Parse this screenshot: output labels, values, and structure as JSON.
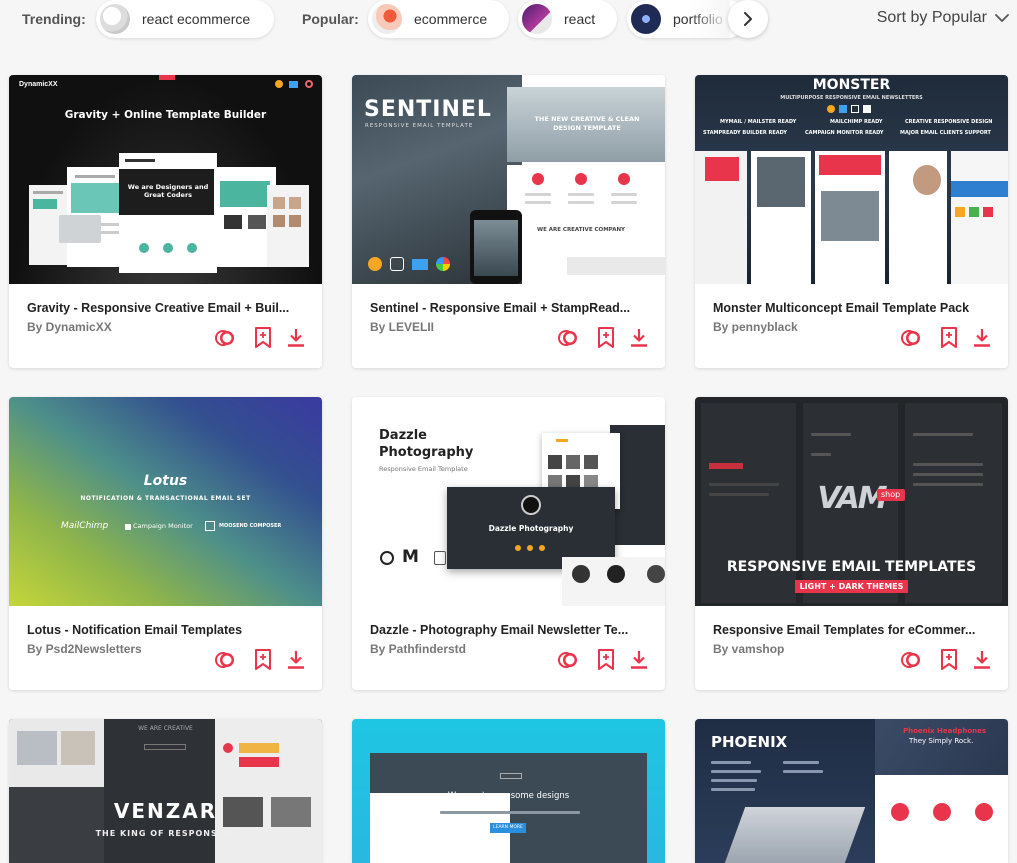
{
  "filters": {
    "trending_label": "Trending:",
    "popular_label": "Popular:",
    "trending": [
      {
        "label": "react ecommerce"
      }
    ],
    "popular": [
      {
        "label": "ecommerce"
      },
      {
        "label": "react"
      },
      {
        "label": "portfolio"
      }
    ],
    "next_icon": "chevron-right-icon"
  },
  "sort": {
    "label": "Sort by Popular",
    "icon": "chevron-down-icon"
  },
  "accent_color": "#e8354b",
  "cards": [
    {
      "title": "Gravity - Responsive Creative Email + Buil...",
      "author": "By DynamicXX",
      "thumb": {
        "brand": "DynamicXX",
        "headline": "Gravity + Online Template Builder",
        "tagline": "We are Designers and Great Coders"
      }
    },
    {
      "title": "Sentinel - Responsive Email + StampRead...",
      "author": "By LEVELII",
      "thumb": {
        "brand": "SENTINEL",
        "subtitle": "RESPONSIVE EMAIL TEMPLATE",
        "headline": "THE NEW CREATIVE & CLEAN DESIGN TEMPLATE",
        "company": "WE ARE CREATIVE COMPANY"
      }
    },
    {
      "title": "Monster Multiconcept Email Template Pack",
      "author": "By pennyblack",
      "thumb": {
        "brand": "MONSTER",
        "subtitle": "MULTIPURPOSE RESPONSIVE EMAIL NEWSLETTERS",
        "features": [
          "MYMAIL / MAILSTER READY",
          "MAILCHIMP READY",
          "CREATIVE RESPONSIVE DESIGN",
          "STAMPREADY BUILDER READY",
          "CAMPAIGN MONITOR READY",
          "MAJOR EMAIL CLIENTS SUPPORT"
        ]
      }
    },
    {
      "title": "Lotus - Notification Email Templates",
      "author": "By Psd2Newsletters",
      "thumb": {
        "brand": "Lotus",
        "subtitle": "NOTIFICATION & TRANSACTIONAL EMAIL SET",
        "partners": [
          "MailChimp",
          "Campaign Monitor",
          "MOOSEND COMPOSER"
        ]
      }
    },
    {
      "title": "Dazzle - Photography Email Newsletter Te...",
      "author": "By Pathfinderstd",
      "thumb": {
        "headline": "Dazzle Photography",
        "subtitle": "Responsive Email Template",
        "inner": "Dazzle Photography"
      }
    },
    {
      "title": "Responsive Email Templates for eCommer...",
      "author": "By vamshop",
      "thumb": {
        "brand": "VAM",
        "badge": "shop",
        "headline": "RESPONSIVE EMAIL TEMPLATES",
        "subtitle": "LIGHT + DARK THEMES"
      }
    },
    {
      "title": "",
      "author": "",
      "thumb": {
        "top": "WE ARE CREATIVE",
        "brand": "VENZAR",
        "subtitle": "THE KING OF RESPONSIVE"
      }
    },
    {
      "title": "",
      "author": "",
      "thumb": {
        "headline": "We create awesome designs",
        "button": "LEARN MORE"
      }
    },
    {
      "title": "",
      "author": "",
      "thumb": {
        "brand": "PHOENIX",
        "headline": "Phoenix Headphones",
        "subline": "They Simply Rock."
      }
    }
  ]
}
